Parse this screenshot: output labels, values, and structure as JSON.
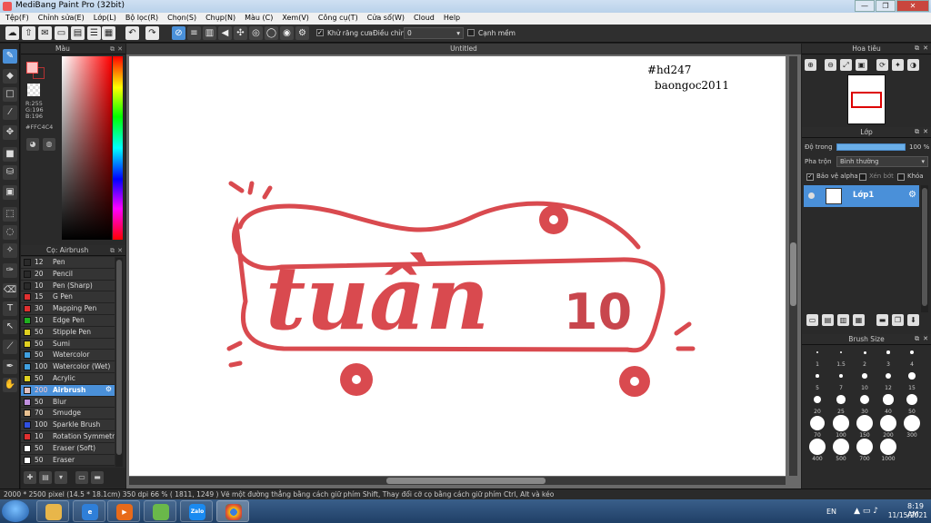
{
  "window": {
    "title": "MediBang Paint Pro (32bit)",
    "min": "—",
    "max": "❐",
    "close": "✕"
  },
  "menu": [
    "Tệp(F)",
    "Chỉnh sửa(E)",
    "Lớp(L)",
    "Bộ lọc(R)",
    "Chọn(S)",
    "Chụp(N)",
    "Màu (C)",
    "Xem(V)",
    "Công cụ(T)",
    "Cửa sổ(W)",
    "Cloud",
    "Help"
  ],
  "toolbar": {
    "antialias_label": "Khử răng cưa",
    "adjust_label": "Điều chỉnh",
    "adjust_value": "0",
    "edge_label": "Cạnh mềm"
  },
  "color_panel": {
    "title": "Màu",
    "r": "R:255",
    "g": "G:196",
    "b": "B:196",
    "hex": "#FFC4C4"
  },
  "brush_panel": {
    "title": "Cọ: Airbrush",
    "brushes": [
      {
        "size": "12",
        "name": "Pen",
        "color": "#2a2a2a"
      },
      {
        "size": "20",
        "name": "Pencil",
        "color": "#2a2a2a"
      },
      {
        "size": "10",
        "name": "Pen (Sharp)",
        "color": "#2a2a2a"
      },
      {
        "size": "15",
        "name": "G Pen",
        "color": "#e03030"
      },
      {
        "size": "30",
        "name": "Mapping Pen",
        "color": "#e03030"
      },
      {
        "size": "10",
        "name": "Edge Pen",
        "color": "#20b020"
      },
      {
        "size": "50",
        "name": "Stipple Pen",
        "color": "#e0d020"
      },
      {
        "size": "50",
        "name": "Sumi",
        "color": "#e0d020"
      },
      {
        "size": "50",
        "name": "Watercolor",
        "color": "#40a0e0"
      },
      {
        "size": "100",
        "name": "Watercolor (Wet)",
        "color": "#40a0e0"
      },
      {
        "size": "50",
        "name": "Acrylic",
        "color": "#e0d020"
      },
      {
        "size": "200",
        "name": "Airbrush",
        "color": "#e0c0c0"
      },
      {
        "size": "50",
        "name": "Blur",
        "color": "#c090e0"
      },
      {
        "size": "70",
        "name": "Smudge",
        "color": "#e8c090"
      },
      {
        "size": "100",
        "name": "Sparkle Brush",
        "color": "#3050e0"
      },
      {
        "size": "10",
        "name": "Rotation Symmetry",
        "color": "#e03030"
      },
      {
        "size": "50",
        "name": "Eraser (Soft)",
        "color": "#ffffff"
      },
      {
        "size": "50",
        "name": "Eraser",
        "color": "#ffffff"
      }
    ],
    "selected_index": 11
  },
  "canvas": {
    "tab_title": "Untitled",
    "watermark_line1": "#hd247",
    "watermark_line2": "baongoc2011",
    "art_text": "tuần",
    "art_number": "10",
    "art_color": "#d94a4f"
  },
  "navigator": {
    "title": "Hoa tiêu"
  },
  "layers": {
    "title": "Lớp",
    "opacity_label": "Độ trong",
    "opacity_value": "100 %",
    "opacity_fraction": 1.0,
    "blend_label": "Pha trộn",
    "blend_value": "Bình thường",
    "protect_alpha": "Bảo vệ alpha",
    "clipping": "Xén bớt",
    "lock": "Khóa",
    "layer_name": "Lớp1"
  },
  "brush_size": {
    "title": "Brush Size",
    "sizes": [
      "1",
      "1.5",
      "2",
      "3",
      "4",
      "5",
      "7",
      "10",
      "12",
      "15",
      "20",
      "25",
      "30",
      "40",
      "50",
      "70",
      "100",
      "150",
      "200",
      "300",
      "400",
      "500",
      "700",
      "1000"
    ]
  },
  "status": {
    "text": "2000 * 2500 pixel   (14.5 * 18.1cm)   350 dpi   66 %   ( 1811, 1249 )   Vẽ một đường thẳng bằng cách giữ phím Shift, Thay đổi cỡ cọ bằng cách giữ phím Ctrl, Alt và kéo"
  },
  "taskbar": {
    "lang": "EN",
    "time": "8:19 AM",
    "date": "11/15/2021",
    "zalo": "Zalo"
  }
}
